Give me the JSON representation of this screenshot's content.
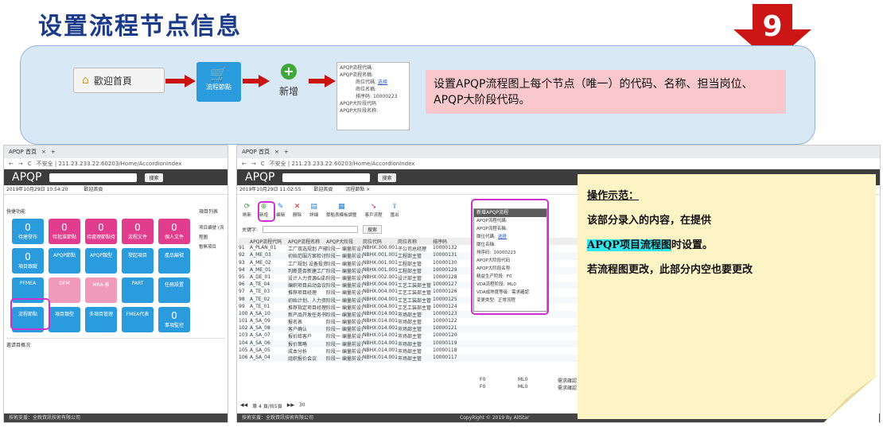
{
  "title": "设置流程节点信息",
  "step_number": "9",
  "top": {
    "welcome": "歡迎首頁",
    "flow_tile": "流程節點",
    "add": "新增",
    "form_labels": [
      "APQP流程代碼:",
      "APQP流程名稱:",
      "崗位代碼:",
      "崗位名稱:",
      "排序码:",
      "APQP大阶段代码",
      "APQP大阶段名称:"
    ],
    "form_link": "选择",
    "form_sort_value": "10000223",
    "description": "设置APQP流程图上每个节点（唯一）的代码、名称、担当岗位、APQP大阶段代码。"
  },
  "win1": {
    "tab": "APQP 首頁",
    "url": "不安全 | 211.23.233.22:60203/Home/AccordionIndex",
    "app": "APQP",
    "search_btn": "搜索",
    "datetime": "2019年10月29日 10:54:20",
    "home_tab": "歡迎首頁",
    "quick_label": "快捷功能",
    "list_label": "項目列表",
    "list_items": [
      "项目编號 (流程圖",
      "暫無項目"
    ],
    "overview": "邀请目概况",
    "tiles": [
      {
        "label": "待建發布",
        "num": "0",
        "color": "#2a9bdc"
      },
      {
        "label": "待批准節點",
        "num": "0",
        "color": "#e23c8e"
      },
      {
        "label": "待處理節點待",
        "num": "0",
        "color": "#e23c8e"
      },
      {
        "label": "流程文件",
        "num": "0",
        "color": "#e23c8e"
      },
      {
        "label": "個人文件",
        "num": "0",
        "color": "#e23c8e"
      },
      {
        "label": "項目跟蹤",
        "num": "0",
        "color": "#2a9bdc"
      },
      {
        "label": "APQP節點",
        "num": "",
        "color": "#2a9bdc"
      },
      {
        "label": "APQP類型",
        "num": "",
        "color": "#2a9bdc"
      },
      {
        "label": "發起項目",
        "num": "",
        "color": "#2a9bdc"
      },
      {
        "label": "產品編號",
        "num": "",
        "color": "#2a9bdc"
      },
      {
        "label": "PFMEA",
        "num": "",
        "color": "#2a9bdc"
      },
      {
        "label": "DFM",
        "num": "",
        "color": "#f29abb"
      },
      {
        "label": "MRA-表",
        "num": "",
        "color": "#f29abb"
      },
      {
        "label": "PART",
        "num": "",
        "color": "#2a9bdc"
      },
      {
        "label": "任務設置",
        "num": "",
        "color": "#2a9bdc"
      },
      {
        "label": "流程節點",
        "num": "",
        "color": "#2a9bdc"
      },
      {
        "label": "項目類型",
        "num": "",
        "color": "#2a9bdc"
      },
      {
        "label": "多項目管理",
        "num": "",
        "color": "#2a9bdc"
      },
      {
        "label": "FMEA代表",
        "num": "",
        "color": "#2a9bdc"
      },
      {
        "label": "事項監控",
        "num": "0",
        "color": "#2a9bdc"
      }
    ],
    "footer": "技術支援：全銳資訊技術有限公司"
  },
  "win2": {
    "tab": "APQP 首頁",
    "url": "不安全 | 211.23.233.22:60203/Home/AccordionIndex",
    "app": "APQP",
    "search_btn": "搜索",
    "datetime": "2019年10月29日 11:02:55",
    "home_tab": "歡迎首頁",
    "node_tab": "流程節點 ×",
    "toolbar": [
      "刷新",
      "新增",
      "编辑",
      "删除",
      "詳細",
      "節點表模板調整",
      "客戶流程",
      "匯出"
    ],
    "keyword_label": "关键字:",
    "headers": [
      "",
      "APQP流程代码",
      "APQP流程名称",
      "APQP大阶段",
      "岗位代码",
      "岗位名称",
      "排序码"
    ],
    "rows": [
      [
        "91",
        "A_PLAN_01",
        "工厂双选规划 产能",
        "阶段一 编量前设计",
        "NBHX.300.001",
        "子公司总经理",
        "10000132"
      ],
      [
        "92",
        "A_ME_03",
        "初始范围方案检讨",
        "阶段一 编量前设计",
        "NBHX.001.001",
        "工程部主管",
        "10000131"
      ],
      [
        "93",
        "A_ME_02",
        "工厂规划 设备投资",
        "阶段一 编量前设计",
        "NBHX.001.001",
        "工程部主管",
        "10000130"
      ],
      [
        "94",
        "A_ME_01",
        "判断是否新建工厂",
        "阶段一 编量前设计",
        "NBHX.001.001",
        "工程部主管",
        "10000129"
      ],
      [
        "95",
        "A_DE_01",
        "设计入力资源&成本",
        "阶段一 编量前设计",
        "NBHX.002.001",
        "设计部主管",
        "10000128"
      ],
      [
        "96",
        "A_TE_04",
        "编织项目启动会议",
        "阶段一 编量前设计",
        "NBHX.004.001",
        "工艺工装部主管",
        "10000127"
      ],
      [
        "97",
        "A_TE_03",
        "推荐项目经理",
        "阶段一 编量前设计",
        "NBHX.004.001",
        "工艺工装部主管",
        "10000126"
      ],
      [
        "98",
        "A_TE_02",
        "初始计划、人力资源",
        "阶段一 编量前设计",
        "NBHX.004.001",
        "工艺工装部主管",
        "10000125"
      ],
      [
        "99",
        "A_TE_01",
        "推荐指定项目经理",
        "阶段一 编量前设计",
        "NBHX.004.001",
        "工艺工装部主管",
        "10000124"
      ],
      [
        "100",
        "A_SA_10",
        "新产品开发任务书",
        "阶段一 编量前设计",
        "NBHX.014.001",
        "市场部主管",
        "10000123"
      ],
      [
        "101",
        "A_SA_09",
        "报名表",
        "阶段一 编量前设计",
        "NBHX.014.001",
        "市场部主管",
        "10000122"
      ],
      [
        "102",
        "A_SA_08",
        "客户确认",
        "阶段一 编量前设计",
        "NBHX.014.001",
        "市场部主管",
        "10000121"
      ],
      [
        "103",
        "A_SA_07",
        "报价给客户",
        "阶段一 编量前设计",
        "NBHX.014.001",
        "市场部主管",
        "10000120"
      ],
      [
        "104",
        "A_SA_06",
        "报价策略",
        "阶段一 编量前设计",
        "NBHX.014.001",
        "市场部主管",
        "10000119"
      ],
      [
        "105",
        "A_SA_05",
        "成本分析",
        "阶段一 编量前设计",
        "NBHX.014.001",
        "市场部主管",
        "10000118"
      ],
      [
        "106",
        "A_SA_04",
        "组织报价会议",
        "阶段一 编量前设计",
        "NBHX.014.001",
        "市场部主管",
        "10000117"
      ]
    ],
    "extra_cols": [
      [
        "F0",
        "ML0",
        "需求確認"
      ],
      [
        "F0",
        "ML0",
        "需求確認"
      ]
    ],
    "pager": "第 4 頁/共5頁",
    "pagesize": "30",
    "footer": "技術支援：全銳資訊技術有限公司",
    "copyright": "CopyRight © 2019 By AllStar",
    "form": {
      "title": "新增APQP流程",
      "labels": [
        "APQP流程代碼:",
        "APQP流程名稱:",
        "崗位代碼:",
        "崗位名稱:",
        "排序码:",
        "APQP大阶段代码",
        "APQP大阶段名称:",
        "精益生产阶段:",
        "VDA流程阶段:",
        "VDA成熟度等级:",
        "变更类型:"
      ],
      "link": "选择",
      "sort_value": "10000223",
      "lean": "F0",
      "vda_flow": "ML0",
      "vda_level": "需求確認",
      "change": "正常流程"
    }
  },
  "note": {
    "heading": "操作示范：",
    "line1": "该部分录入的内容，在提供",
    "highlight": "APQP项目流程图",
    "line2_rest": "时设置。",
    "line3": "若流程图更改，此部分内空也要更改"
  }
}
